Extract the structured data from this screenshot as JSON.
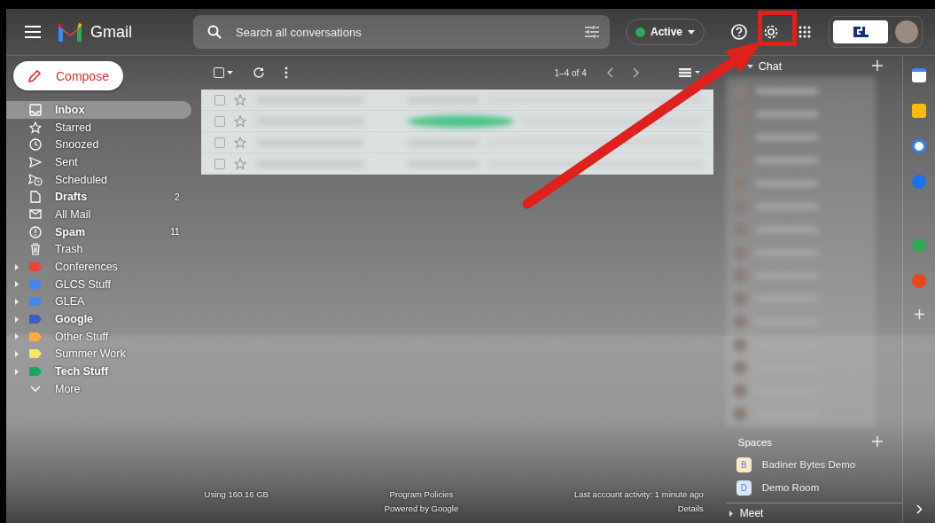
{
  "header": {
    "app_name": "Gmail",
    "search": {
      "placeholder": "Search all conversations"
    },
    "status": "Active",
    "status_on": true
  },
  "compose": {
    "label": "Compose"
  },
  "nav": [
    {
      "kind": "system",
      "label": "Inbox",
      "bold": true,
      "selected": true
    },
    {
      "kind": "system",
      "label": "Starred",
      "bold": false,
      "selected": false
    },
    {
      "kind": "system",
      "label": "Snoozed",
      "bold": false,
      "selected": false
    },
    {
      "kind": "system",
      "label": "Sent",
      "bold": false,
      "selected": false
    },
    {
      "kind": "system",
      "label": "Scheduled",
      "bold": false,
      "selected": false
    },
    {
      "kind": "system",
      "label": "Drafts",
      "count": "2",
      "bold": true,
      "selected": false
    },
    {
      "kind": "system",
      "label": "All Mail",
      "bold": false,
      "selected": false
    },
    {
      "kind": "system",
      "label": "Spam",
      "count": "11",
      "bold": true,
      "selected": false
    },
    {
      "kind": "system",
      "label": "Trash",
      "bold": false,
      "selected": false
    },
    {
      "kind": "label",
      "label": "Conferences",
      "color": "#ea4335",
      "bold": false,
      "selected": false
    },
    {
      "kind": "label",
      "label": "GLCS Stuff",
      "color": "#4285f4",
      "bold": false,
      "selected": false
    },
    {
      "kind": "label",
      "label": "GLEA",
      "color": "#4285f4",
      "bold": false,
      "selected": false
    },
    {
      "kind": "label",
      "label": "Google",
      "color": "#3c5fc4",
      "bold": true,
      "selected": false
    },
    {
      "kind": "label",
      "label": "Other Stuff",
      "color": "#fbac3d",
      "bold": false,
      "selected": false
    },
    {
      "kind": "label",
      "label": "Summer Work",
      "color": "#fbe46a",
      "bold": false,
      "selected": false
    },
    {
      "kind": "label",
      "label": "Tech Stuff",
      "color": "#16a765",
      "bold": true,
      "selected": false
    },
    {
      "kind": "more",
      "label": "More",
      "bold": false,
      "selected": false
    }
  ],
  "toolbar": {
    "pager": "1–4 of 4",
    "select_all_checked": false
  },
  "email_rows": [
    {
      "starred": false,
      "checked": false
    },
    {
      "starred": false,
      "checked": false
    },
    {
      "starred": false,
      "checked": false
    },
    {
      "starred": false,
      "checked": false
    }
  ],
  "chat": {
    "title": "Chat",
    "spaces_title": "Spaces",
    "spaces": [
      {
        "letter": "B",
        "name": "Badiner Bytes Demo",
        "color": "#fbe9c4"
      },
      {
        "letter": "D",
        "name": "Demo Room",
        "color": "#dbe6fb"
      }
    ],
    "meet_title": "Meet"
  },
  "footer": {
    "storage": "Using 160.16 GB",
    "policies": "Program Policies",
    "powered": "Powered by Google",
    "activity": "Last account activity: 1 minute ago",
    "details": "Details"
  }
}
